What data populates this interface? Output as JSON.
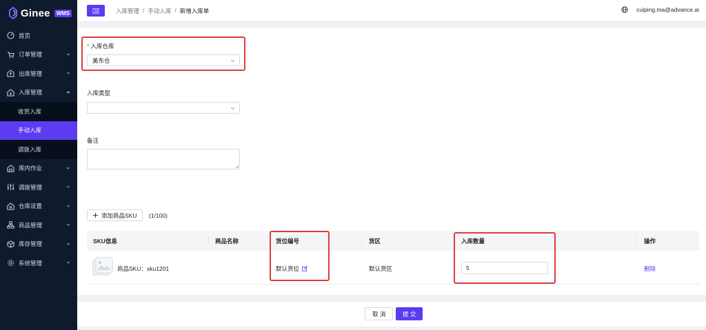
{
  "brand": {
    "name": "Ginee",
    "badge": "WMS"
  },
  "sidebar": {
    "items": [
      {
        "label": "首页",
        "icon": "dashboard-icon"
      },
      {
        "label": "订单管理",
        "icon": "cart-icon"
      },
      {
        "label": "出库管理",
        "icon": "outbound-icon"
      },
      {
        "label": "入库管理",
        "icon": "inbound-icon"
      },
      {
        "label": "库内作业",
        "icon": "warehouse-task-icon"
      },
      {
        "label": "调拨管理",
        "icon": "sliders-icon"
      },
      {
        "label": "仓库设置",
        "icon": "home-settings-icon"
      },
      {
        "label": "商品管理",
        "icon": "hierarchy-icon"
      },
      {
        "label": "库存管理",
        "icon": "box-icon"
      },
      {
        "label": "系统管理",
        "icon": "gear-icon"
      }
    ],
    "inbound_sub": [
      {
        "label": "收货入库"
      },
      {
        "label": "手动入库"
      },
      {
        "label": "调拨入库"
      }
    ]
  },
  "header": {
    "breadcrumb": [
      "入库管理",
      "/",
      "手动入库",
      "/",
      "新增入库单"
    ],
    "user_email": "cuiping.ma@advance.ai"
  },
  "form": {
    "warehouse": {
      "label": "入库仓库",
      "value": "美东仓"
    },
    "type": {
      "label": "入库类型",
      "value": ""
    },
    "remark": {
      "label": "备注"
    }
  },
  "sku": {
    "add_label": "添加商品SKU",
    "count": "(1/100)",
    "columns": [
      "SKU信息",
      "商品名称",
      "货位编号",
      "货区",
      "入库数量",
      "操作"
    ],
    "rows": [
      {
        "sku": "商品SKU：sku1201",
        "name": "",
        "location": "默认货位",
        "zone": "默认货区",
        "qty": "5",
        "action": "删除"
      }
    ]
  },
  "footer": {
    "cancel": "取 消",
    "submit": "提 交"
  },
  "colors": {
    "accent": "#5b3cf0",
    "sidebar_bg": "#0f1b2d",
    "highlight": "#e03b3b"
  }
}
